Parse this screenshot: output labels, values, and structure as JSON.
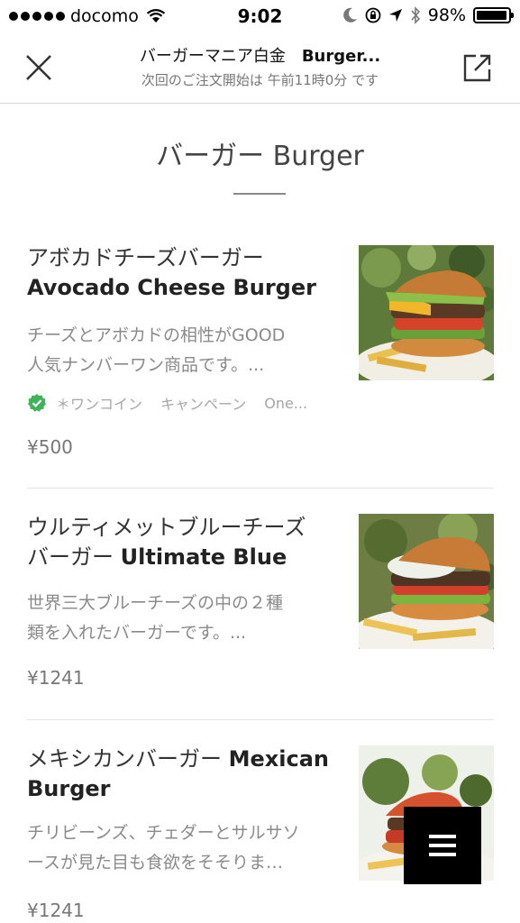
{
  "status": {
    "carrier": "docomo",
    "time": "9:02",
    "battery": "98%",
    "battery_level": 0.98
  },
  "header": {
    "title_jp": "バーガーマニア白金",
    "title_en": "Burger...",
    "subtitle": "次回のご注文開始は 午前11時0分 です"
  },
  "section": {
    "title": "バーガー Burger"
  },
  "items": [
    {
      "name_jp": "アボカドチーズバーガー",
      "name_en": "Avocado Cheese Burger",
      "desc_line1": "チーズとアボカドの相性がGOOD",
      "desc_line2": "人気ナンバーワン商品です。...",
      "badge1": "＊ワンコイン",
      "badge2": "キャンペーン",
      "badge3": "One...",
      "price": "¥500"
    },
    {
      "name_jp1": "ウルティメットブルーチーズ",
      "name_jp2": "バーガー",
      "name_en": "Ultimate Blue",
      "desc_line1": "世界三大ブルーチーズの中の２種",
      "desc_line2": "類を入れたバーガーです。...",
      "price": "¥1241"
    },
    {
      "name_jp": "メキシカンバーガー",
      "name_en1": "Mexican",
      "name_en2": "Burger",
      "desc_line1": "チリビーンズ、チェダーとサルサソ",
      "desc_line2": "ースが見た目も食欲をそそりま…",
      "price": "¥1241"
    }
  ],
  "colors": {
    "check_green": "#3fb35a",
    "fab_bg": "#000000"
  }
}
